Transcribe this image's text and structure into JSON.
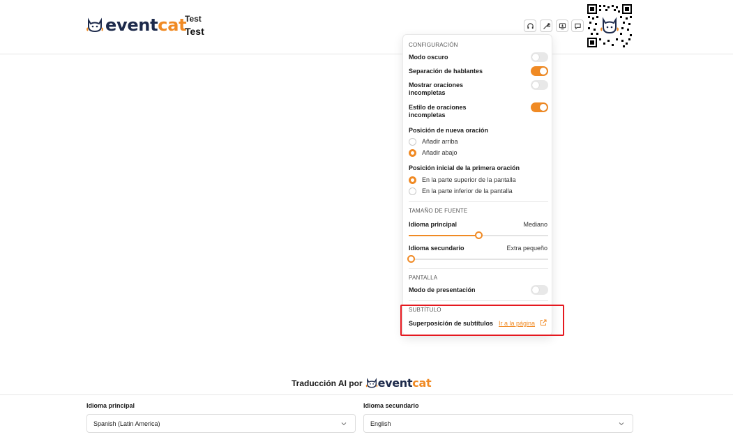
{
  "header": {
    "logo": {
      "part1": "event",
      "part2": "cat"
    },
    "event_subtitle": "Test",
    "event_title": "Test",
    "tools": [
      {
        "icon": "headphones-icon"
      },
      {
        "icon": "wrench-icon"
      },
      {
        "icon": "download-screen-icon"
      },
      {
        "icon": "chat-icon"
      }
    ]
  },
  "settings_menu": {
    "config_title": "CONFIGURACIÓN",
    "dark_mode": {
      "label": "Modo oscuro",
      "on": false
    },
    "speaker_sep": {
      "label": "Separación de hablantes",
      "on": true
    },
    "show_incomplete": {
      "label1": "Mostrar oraciones",
      "label2": "incompletas",
      "on": false
    },
    "incomplete_style": {
      "label1": "Estilo de oraciones",
      "label2": "incompletas",
      "on": true
    },
    "new_sentence_position": {
      "label": "Posición de nueva oración",
      "options": [
        "Añadir arriba",
        "Añadir abajo"
      ],
      "selected": "Añadir abajo"
    },
    "first_sentence_position": {
      "label": "Posición inicial de la primera oración",
      "options": [
        "En la parte superior de la pantalla",
        "En la parte inferior de la pantalla"
      ],
      "selected": "En la parte superior de la pantalla"
    },
    "font_size_title": "TAMAÑO DE FUENTE",
    "primary_lang": {
      "label": "Idioma principal",
      "value": "Mediano",
      "level": 0.5
    },
    "secondary_lang": {
      "label": "Idioma secundario",
      "value": "Extra pequeño",
      "level": 0
    },
    "screen_title": "PANTALLA",
    "presentation_mode": {
      "label": "Modo de presentación",
      "on": false
    },
    "subtitle_title": "SUBTÍTULO",
    "subtitle_overlay": {
      "label": "Superposición de subtítulos",
      "link": "Ir a la página",
      "icon": "external-link-icon"
    }
  },
  "footer": {
    "powered_text": "Traducción AI por",
    "primary_label": "Idioma principal",
    "primary_value": "Spanish (Latin America)",
    "secondary_label": "Idioma secundario",
    "secondary_value": "English"
  },
  "colors": {
    "accent": "#f08a24",
    "brand_dark": "#1d2a4b",
    "highlight": "#e5181f"
  }
}
